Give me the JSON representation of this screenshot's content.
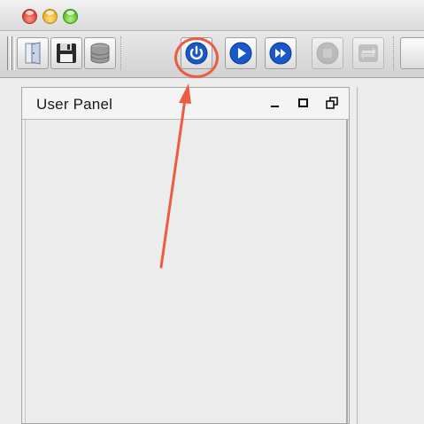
{
  "window": {
    "traffic_lights": [
      {
        "name": "close",
        "color": "#e0443a"
      },
      {
        "name": "minimize",
        "color": "#f0b02a"
      },
      {
        "name": "zoom",
        "color": "#5ec32f"
      }
    ]
  },
  "toolbar": {
    "buttons": [
      {
        "name": "open",
        "icon": "open-file-icon",
        "enabled": true
      },
      {
        "name": "save",
        "icon": "floppy-disk-icon",
        "enabled": true
      },
      {
        "name": "database",
        "icon": "database-icon",
        "enabled": true
      },
      {
        "name": "connect",
        "icon": "power-icon",
        "enabled": true,
        "highlighted": true
      },
      {
        "name": "start",
        "icon": "play-icon",
        "enabled": true
      },
      {
        "name": "fast-forward",
        "icon": "fast-forward-icon",
        "enabled": true
      },
      {
        "name": "stop",
        "icon": "stop-icon",
        "enabled": false
      },
      {
        "name": "reload",
        "icon": "swap-arrows-icon",
        "enabled": false
      }
    ]
  },
  "user_panel": {
    "title": "User Panel"
  },
  "annotation": {
    "color": "#ec5c43",
    "target": "connect"
  },
  "colors": {
    "accent_blue": "#1858c8",
    "annotation": "#ec5c43"
  }
}
